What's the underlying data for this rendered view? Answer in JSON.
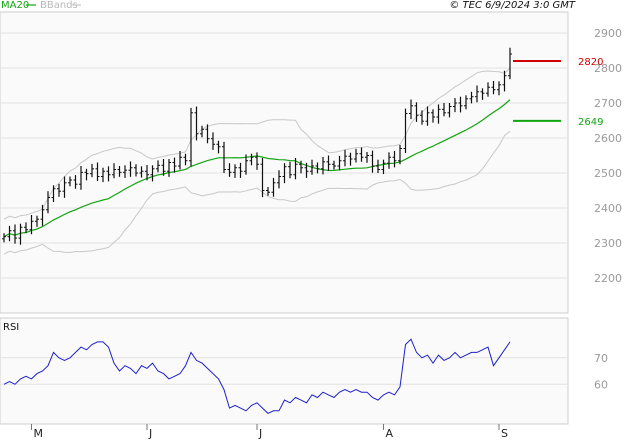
{
  "header": {
    "source": "© TEC 6/9/2024 3:0 GMT"
  },
  "legend": {
    "ma_label": "MA20",
    "bands_label": "BBands"
  },
  "colors": {
    "ma": "#12a512",
    "bands": "#c8c8c8",
    "price": "#111111",
    "rsi": "#1f1fcc",
    "resistance": "#cc0000",
    "support": "#12a512",
    "grid": "#e2e2e2",
    "plot_bg": "#fafafa"
  },
  "chart_data": [
    {
      "type": "ohlc",
      "series_names": [
        "MA20",
        "BBands"
      ],
      "ylim": [
        2100,
        2960
      ],
      "y_ticks": [
        "2200",
        "2300",
        "2400",
        "2500",
        "2600",
        "2700",
        "2800",
        "2900"
      ],
      "x_labels": [
        {
          "label": "M",
          "index": 5
        },
        {
          "label": "J",
          "index": 26
        },
        {
          "label": "J",
          "index": 46
        },
        {
          "label": "A",
          "index": 69
        },
        {
          "label": "S",
          "index": 90
        }
      ],
      "num_bars": 93,
      "close": [
        2318,
        2335,
        2314,
        2345,
        2338,
        2362,
        2368,
        2395,
        2430,
        2455,
        2448,
        2472,
        2480,
        2468,
        2502,
        2498,
        2512,
        2490,
        2505,
        2495,
        2510,
        2502,
        2508,
        2515,
        2500,
        2505,
        2495,
        2512,
        2522,
        2505,
        2530,
        2520,
        2545,
        2535,
        2672,
        2612,
        2625,
        2598,
        2582,
        2575,
        2510,
        2502,
        2515,
        2505,
        2535,
        2545,
        2525,
        2450,
        2445,
        2472,
        2490,
        2518,
        2495,
        2525,
        2515,
        2505,
        2520,
        2512,
        2532,
        2525,
        2520,
        2535,
        2548,
        2540,
        2555,
        2545,
        2550,
        2520,
        2510,
        2528,
        2545,
        2535,
        2570,
        2670,
        2692,
        2665,
        2648,
        2672,
        2660,
        2682,
        2672,
        2690,
        2700,
        2692,
        2712,
        2718,
        2732,
        2728,
        2745,
        2738,
        2752,
        2778,
        2840
      ],
      "levels": [
        {
          "label": "2820",
          "value": 2820,
          "color": "#cc0000"
        },
        {
          "label": "2649",
          "value": 2649,
          "color": "#12a512"
        }
      ]
    },
    {
      "type": "line",
      "title": "RSI",
      "ylim": [
        45,
        85
      ],
      "y_ticks": [
        "60",
        "70"
      ],
      "values": [
        60,
        61,
        60,
        62,
        63,
        62,
        64,
        65,
        67,
        72,
        70,
        69,
        70,
        72,
        74,
        73,
        75,
        76,
        76,
        74,
        68,
        65,
        67,
        66,
        64,
        67,
        66,
        68,
        65,
        64,
        62,
        63,
        64,
        67,
        72,
        69,
        68,
        66,
        64,
        62,
        58,
        51,
        52,
        51,
        50,
        52,
        53,
        51,
        49,
        50,
        50,
        54,
        53,
        55,
        54,
        53,
        56,
        55,
        57,
        56,
        55,
        57,
        58,
        57,
        58,
        57,
        57,
        55,
        54,
        56,
        57,
        56,
        59,
        75,
        77,
        72,
        70,
        71,
        68,
        71,
        69,
        70,
        72,
        70,
        71,
        72,
        72,
        73,
        74,
        67,
        70,
        73,
        76
      ]
    }
  ]
}
